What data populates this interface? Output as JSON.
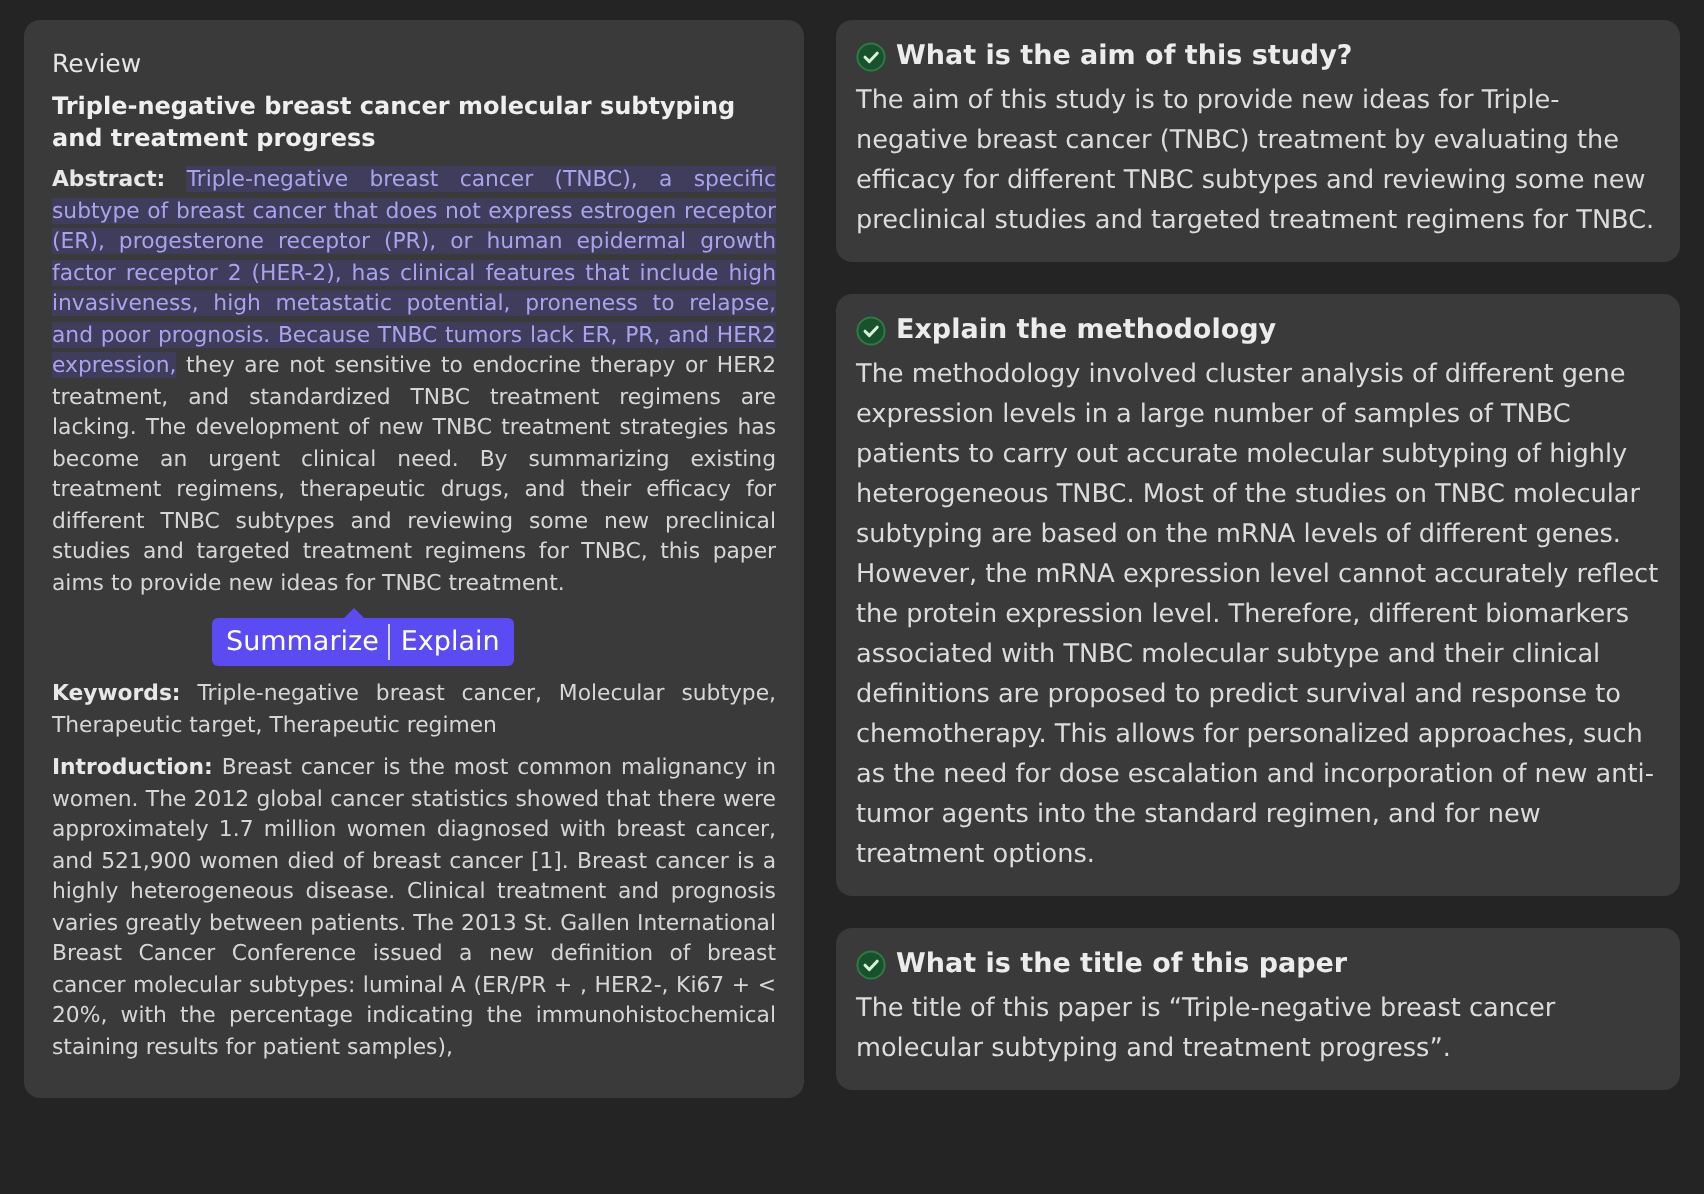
{
  "review": {
    "label": "Review",
    "title": "Triple-negative breast cancer molecular subtyping and treatment progress",
    "abstract": {
      "label": "Abstract:",
      "selected_text": "Triple-negative breast cancer (TNBC), a specific subtype of breast cancer that does not express estrogen receptor (ER), progesterone receptor (PR), or human epidermal growth factor receptor 2 (HER-2), has clinical features that include high invasiveness, high metastatic potential, proneness to relapse, and poor prognosis. Because TNBC tumors lack ER, PR, and HER2 expression,",
      "text": " they are not sensitive to endocrine therapy or HER2 treatment, and standardized TNBC treatment regimens are lacking. The development of new TNBC treatment strategies has become an urgent clinical need. By summarizing existing treatment regimens, therapeutic drugs, and their efficacy for different TNBC subtypes and reviewing some new preclinical studies and targeted treatment regimens for TNBC, this paper aims to provide new ideas for TNBC treatment."
    },
    "sections": [
      {
        "label": "Keywords:",
        "text": "Triple-negative breast cancer, Molecular subtype, Therapeutic target, Therapeutic regimen"
      },
      {
        "label": "Introduction:",
        "text": "Breast cancer is the most common malignancy in women. The 2012 global cancer statistics showed that there were approximately 1.7 million women diagnosed with breast cancer, and 521,900 women died of breast cancer [1]. Breast cancer is a highly heterogeneous disease. Clinical treatment and prognosis varies greatly between patients. The 2013 St. Gallen International Breast Cancer Conference issued a new definition of breast cancer molecular subtypes: luminal A (ER/PR + , HER2-, Ki67 + < 20%, with the percentage indicating the immunohistochemical staining results for patient samples),"
      }
    ]
  },
  "selection_popup": {
    "actions": [
      "Summarize",
      "Explain"
    ]
  },
  "answers": [
    {
      "question": "What is the aim of this study?",
      "answer": "The aim of this study is to provide new ideas for Triple-negative breast cancer (TNBC) treatment by evaluating the efficacy for different TNBC subtypes and reviewing some new preclinical studies and targeted treatment regimens for TNBC."
    },
    {
      "question": "Explain the methodology",
      "answer": "The methodology involved cluster analysis of different gene expression levels in a large number of samples of TNBC patients to carry out accurate molecular subtyping of highly heterogeneous TNBC. Most of the studies on TNBC molecular subtyping are based on the mRNA levels of different genes. However, the mRNA expression level cannot accurately reflect the protein expression level. Therefore, different biomarkers associated with TNBC molecular subtype and their clinical definitions are proposed to predict survival and response to chemotherapy. This allows for personalized approaches, such as the need for dose escalation and incorporation of new anti-tumor agents into the standard regimen, and for new treatment options."
    },
    {
      "question": "What is the title of this paper",
      "answer": "The title of this paper is “Triple-negative breast cancer molecular subtyping and treatment progress”."
    }
  ]
}
